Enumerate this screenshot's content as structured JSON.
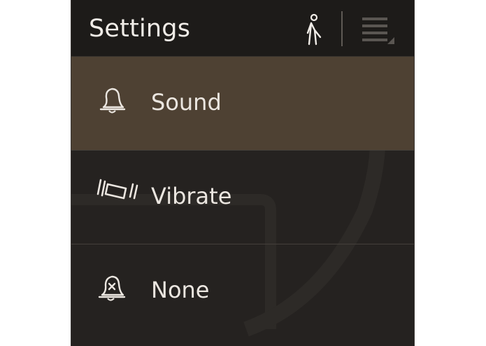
{
  "header": {
    "title": "Settings",
    "icons": [
      "accessibility-icon",
      "menu-icon"
    ]
  },
  "options": [
    {
      "label": "Sound",
      "icon": "bell-icon",
      "selected": true
    },
    {
      "label": "Vibrate",
      "icon": "vibrate-icon",
      "selected": false
    },
    {
      "label": "None",
      "icon": "bell-mute-icon",
      "selected": false
    }
  ],
  "colors": {
    "panel_bg": "#252220",
    "header_bg": "#1d1b19",
    "selected_bg": "#4e4133",
    "text": "#ebe6e0"
  }
}
